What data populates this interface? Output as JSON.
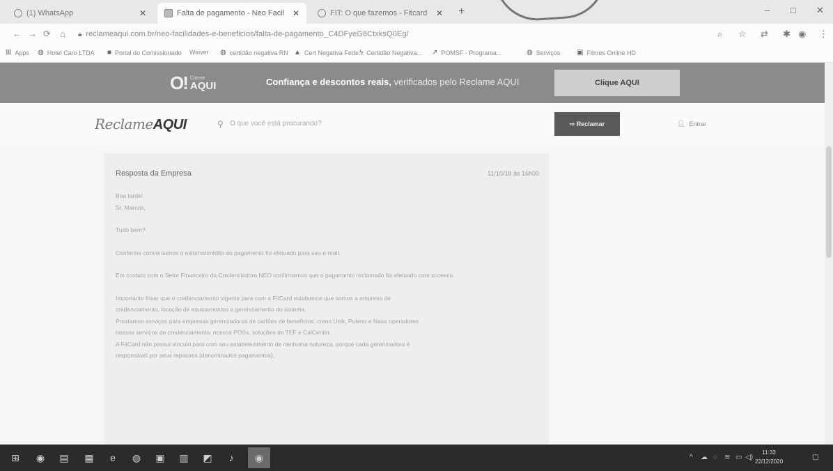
{
  "browser": {
    "tabs": [
      {
        "title": "(1) WhatsApp",
        "active": false
      },
      {
        "title": "Falta de pagamento - Neo Facil",
        "active": true
      },
      {
        "title": "FIT: O que fazemos - Fitcard",
        "active": false
      }
    ],
    "new_tab": "+",
    "window_controls": {
      "minimize": "–",
      "maximize": "□",
      "close": "✕"
    },
    "url": "reclameaqui.com.br/neo-facilidades-e-beneficios/falta-de-pagamento_C4DFyeG8CtxksQ0Eg/",
    "bookmarks": [
      {
        "label": "Apps",
        "icon": "apps-grid-icon"
      },
      {
        "label": "Hotel Caro LTDA",
        "icon": "globe-icon"
      },
      {
        "label": "Portal do Comissionado",
        "icon": "bookmark-square-icon"
      },
      {
        "label": "Waiver",
        "icon": ""
      },
      {
        "label": "certidão negativa RN",
        "icon": "globe-icon"
      },
      {
        "label": "Cert Negativa Fede...",
        "icon": "drive-icon"
      },
      {
        "label": "Certidão Negativa...",
        "icon": "bolt-icon"
      },
      {
        "label": "POMSF - Programa...",
        "icon": "link-icon"
      },
      {
        "label": "Serviços",
        "icon": "globe-icon"
      },
      {
        "label": "Filmes Online HD",
        "icon": "film-icon"
      }
    ]
  },
  "promo_banner": {
    "logo_small": "Cliente",
    "logo_big": "AQUI",
    "headline_bold": "Confiança e descontos reais,",
    "headline_rest": " verificados pelo Reclame AQUI",
    "button_label": "Clique AQUI"
  },
  "site_header": {
    "brand_light": "Reclame",
    "brand_bold": "AQUI",
    "search_placeholder": "O que você está procurando?",
    "reclamar_label": "Reclamar",
    "entrar_label": "Entrar"
  },
  "response": {
    "title": "Resposta da Empresa",
    "date": "11/10/18 às 16h00",
    "greeting": "Boa tarde!",
    "salutation": "Sr. Marcos,",
    "p1": "Tudo bem?",
    "p2": "Conforme conversamos o estorno/crédito do pagamento foi efetuado para seu e-mail.",
    "p3": "Em contato com o Setor Financeiro da Credenciadora NEO confirmamos que o pagamento reclamado foi efetuado com sucesso.",
    "p4a": "Importante frisar que o credenciamento vigente para com a FitCard estabelece que somos a empresa de",
    "p4b": "credenciamento, locação de equipamentos e gerenciamento do sistema.",
    "p4c": "Prestamos serviços para empresas gerenciadoras de cartões de benefícios, como Unik, Puleno e Nasa operadores",
    "p4d": "nossos serviços de credenciamento, nossos POSs, soluções de TEF e CalCenter.",
    "p4e": "A FitCard não possui vínculo para com seu estabelecimento de nenhuma natureza, porque cada gerenciadora é",
    "p4f": "responsável por seus repasses (denominados pagamentos)."
  },
  "taskbar": {
    "apps": [
      "windows-start-icon",
      "chrome-icon",
      "file-explorer-icon",
      "excel-icon",
      "edge-icon",
      "firefox-icon",
      "outlook-icon",
      "word-icon",
      "paint-icon",
      "groove-icon",
      "chrome-running-icon"
    ],
    "time": "11:33",
    "date": "22/12/2020"
  }
}
